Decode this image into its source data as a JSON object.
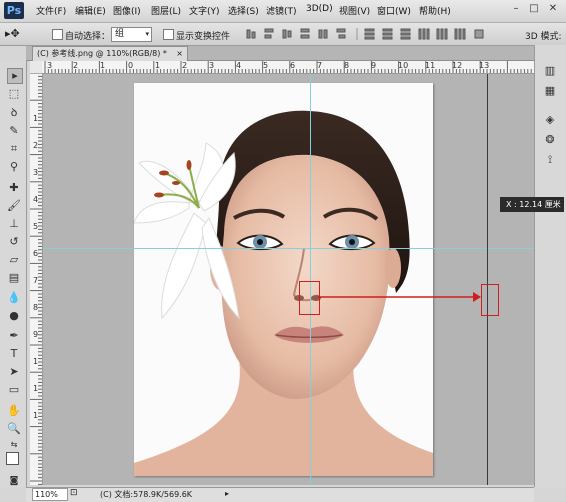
{
  "app": {
    "logo": "Ps"
  },
  "menubar": {
    "items": [
      "文件(F)",
      "编辑(E)",
      "图像(I)",
      "图层(L)",
      "文字(Y)",
      "选择(S)",
      "滤镜(T)",
      "3D(D)",
      "视图(V)",
      "窗口(W)",
      "帮助(H)"
    ],
    "window_controls": [
      "–",
      "□",
      "✕"
    ]
  },
  "options": {
    "auto_select_label": "自动选择：",
    "group_value": "组",
    "show_transform_label": "显示变换控件",
    "mode_label": "3D 模式:"
  },
  "document": {
    "tab_title": "(C) 参考线.png @ 110%(RGB/8) *",
    "close_glyph": "×"
  },
  "ruler": {
    "h_numbers": [
      "3",
      "2",
      "1",
      "0",
      "1",
      "2",
      "3",
      "4",
      "5",
      "6",
      "7",
      "8",
      "9",
      "10",
      "11",
      "12",
      "13"
    ],
    "v_numbers": [
      "1",
      "2",
      "3",
      "4",
      "5",
      "6",
      "7",
      "8",
      "9",
      "1",
      "1",
      "1"
    ]
  },
  "measure": {
    "tooltip": "X : 12.14 厘米"
  },
  "status": {
    "zoom": "110%",
    "doc_info": "(C) 文档:578.9K/569.6K"
  },
  "colors": {
    "annotation_red": "#cc1f1f",
    "guide_cyan": "#7fd6e8"
  }
}
